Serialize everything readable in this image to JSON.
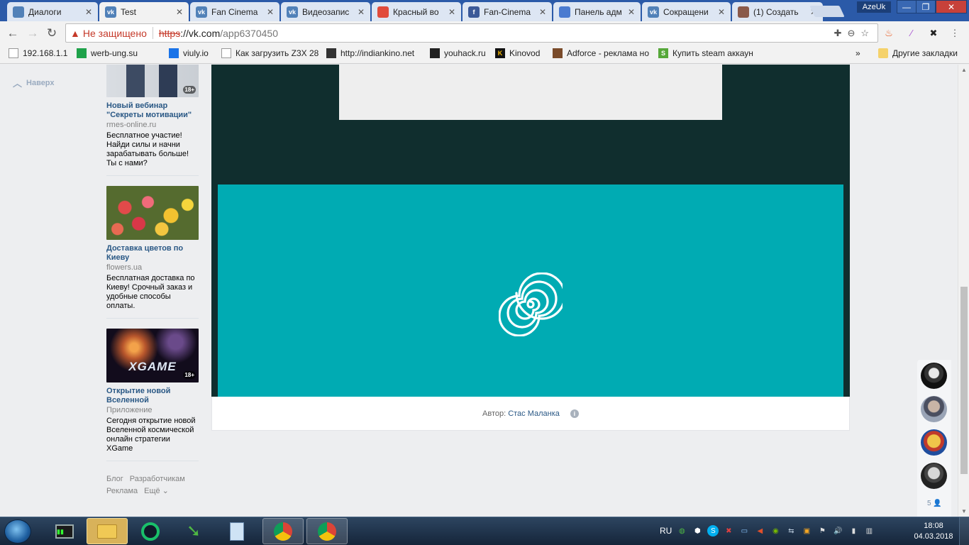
{
  "tabs": [
    {
      "title": "Диалоги",
      "icon": "chat-icon",
      "color": "#5181b8"
    },
    {
      "title": "Test",
      "icon": "vk-icon",
      "color": "#5181b8"
    },
    {
      "title": "Fan Cinema",
      "icon": "vk-icon",
      "color": "#5181b8"
    },
    {
      "title": "Видеозапис",
      "icon": "vk-icon",
      "color": "#5181b8"
    },
    {
      "title": "Красный во",
      "icon": "colorful-icon",
      "color": "#e14b3b"
    },
    {
      "title": "Fan-Cinema",
      "icon": "facebook-icon",
      "color": "#3b5998"
    },
    {
      "title": "Панель адм",
      "icon": "database-icon",
      "color": "#4a7bd0"
    },
    {
      "title": "Сокращени",
      "icon": "vk-icon",
      "color": "#5181b8"
    },
    {
      "title": "(1) Создать",
      "icon": "robot-icon",
      "color": "#8a5a4a"
    }
  ],
  "window": {
    "user": "AzeUk",
    "minimize": "—",
    "maximize": "❐",
    "close": "✕"
  },
  "address": {
    "warning": "Не защищено",
    "protocol": "https",
    "host": "://vk.com",
    "path": "/app6370450"
  },
  "bookmarks": [
    {
      "label": "192.168.1.1",
      "icon": "page-icon"
    },
    {
      "label": "werb-ung.su",
      "icon": "shield-green-icon"
    },
    {
      "label": "viuly.io",
      "icon": "viuly-icon"
    },
    {
      "label": "Как загрузить Z3X 28",
      "icon": "page-icon"
    },
    {
      "label": "http://indiankino.net",
      "icon": "film-icon"
    },
    {
      "label": "youhack.ru",
      "icon": "youhack-icon"
    },
    {
      "label": "Kinovod",
      "icon": "kinovod-icon"
    },
    {
      "label": "Adforce - реклама но",
      "icon": "adforce-icon"
    },
    {
      "label": "Купить steam аккаун",
      "icon": "steam-s-icon"
    }
  ],
  "bookmarks_more": "»",
  "other_bookmarks": "Другие закладки",
  "sidebar": {
    "up_label": "Наверх"
  },
  "ads": [
    {
      "title": "Новый вебинар \"Секреты мотивации\"",
      "domain": "rmes-online.ru",
      "description": "Бесплатное участие! Найди силы и начни зарабатывать больше! Ты с нами?",
      "age": "18+",
      "image": "webinar-speakers"
    },
    {
      "title": "Доставка цветов по Киеву",
      "domain": "flowers.ua",
      "description": "Бесплатная доставка по Киеву! Срочный заказ и удобные способы оплаты.",
      "age": "",
      "image": "tulips"
    },
    {
      "title": "Открытие новой Вселенной",
      "domain": "Приложение",
      "description": "Сегодня открытие новой Вселенной космической онлайн стратегии XGame",
      "age": "18+",
      "image": "xgame-space",
      "image_text": "XGAME"
    }
  ],
  "footer_links": [
    "Блог",
    "Разработчикам",
    "Реклама",
    "Ещё ⌄"
  ],
  "app": {
    "author_label": "Автор:",
    "author_name": "Стас Маланка",
    "info": "i",
    "colors": {
      "dark": "#102e2e",
      "teal": "#00abb3",
      "grey": "#eeeeee"
    }
  },
  "friends_online": {
    "count": "5"
  },
  "taskbar": {
    "language": "RU",
    "time": "18:08",
    "date": "04.03.2018",
    "apps": [
      "terminal-icon",
      "file-explorer-icon",
      "opera-icon",
      "download-manager-icon",
      "calculator-icon",
      "chrome-icon",
      "chrome-icon"
    ]
  }
}
